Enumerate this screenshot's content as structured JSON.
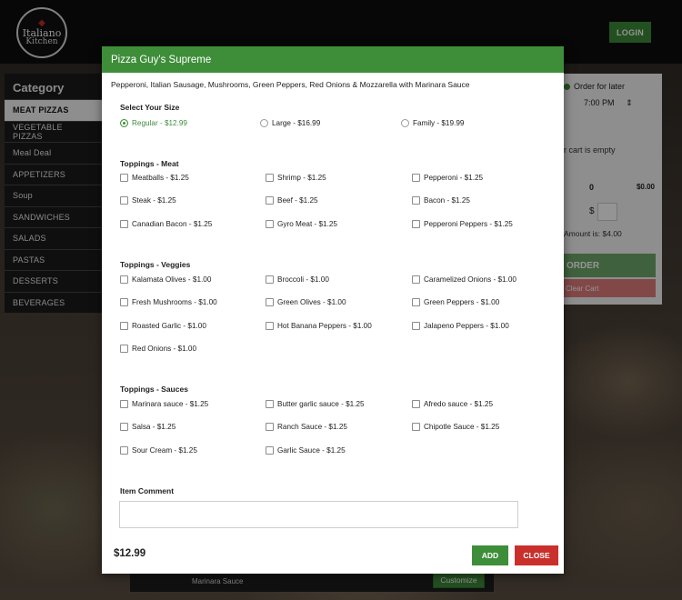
{
  "header": {
    "login_label": "LOGIN"
  },
  "logo": {
    "line1": "Italiano",
    "line2": "Kitchen"
  },
  "sidebar": {
    "title": "Category",
    "items": [
      {
        "label": "MEAT PIZZAS",
        "active": true
      },
      {
        "label": "VEGETABLE PIZZAS"
      },
      {
        "label": "Meal Deal"
      },
      {
        "label": "APPETIZERS"
      },
      {
        "label": "Soup"
      },
      {
        "label": "SANDWICHES"
      },
      {
        "label": "SALADS"
      },
      {
        "label": "PASTAS"
      },
      {
        "label": "DESSERTS"
      },
      {
        "label": "BEVERAGES"
      }
    ]
  },
  "cart": {
    "order_for_later": "Order for later",
    "time": "7:00 PM",
    "empty_text": "r cart is empty",
    "count": "0",
    "total": "$0.00",
    "dollar": "$",
    "amount_text": "Amount is: $4.00",
    "order_label": "ORDER",
    "clear_label": "Clear Cart"
  },
  "background_item": {
    "desc": "Marinara Sauce",
    "customize_label": "Customize"
  },
  "modal": {
    "title": "Pizza Guy's Supreme",
    "description": "Pepperoni, Italian Sausage, Mushrooms, Green Peppers, Red Onions & Mozzarella with Marinara Sauce",
    "size_title": "Select Your Size",
    "sizes": [
      {
        "label": "Regular - $12.99",
        "checked": true
      },
      {
        "label": "Large - $16.99"
      },
      {
        "label": "Family - $19.99"
      }
    ],
    "meat_title": "Toppings - Meat",
    "meat": [
      "Meatballs - $1.25",
      "Shrimp - $1.25",
      "Pepperoni - $1.25",
      "Steak - $1.25",
      "Beef - $1.25",
      "Bacon - $1.25",
      "Canadian Bacon - $1.25",
      "Gyro Meat - $1.25",
      "Pepperoni Peppers - $1.25"
    ],
    "veggies_title": "Toppings - Veggies",
    "veggies": [
      "Kalamata Olives - $1.00",
      "Broccoli - $1.00",
      "Caramelized Onions - $1.00",
      "Fresh Mushrooms - $1.00",
      "Green Olives - $1.00",
      "Green Peppers - $1.00",
      "Roasted Garlic - $1.00",
      "Hot Banana Peppers - $1.00",
      "Jalapeno Peppers - $1.00",
      "Red Onions - $1.00"
    ],
    "sauces_title": "Toppings - Sauces",
    "sauces": [
      "Marinara sauce - $1.25",
      "Butter garlic sauce - $1.25",
      "Afredo sauce - $1.25",
      "Salsa - $1.25",
      "Ranch Sauce - $1.25",
      "Chipotle Sauce - $1.25",
      "Sour Cream - $1.25",
      "Garlic Sauce - $1.25"
    ],
    "comment_title": "Item Comment",
    "price": "$12.99",
    "add_label": "ADD",
    "close_label": "CLOSE"
  }
}
